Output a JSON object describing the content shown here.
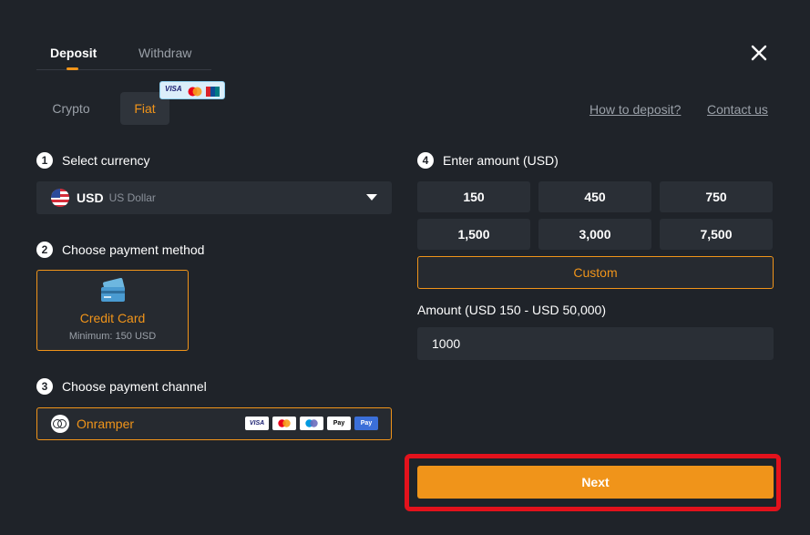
{
  "tabs": {
    "deposit": "Deposit",
    "withdraw": "Withdraw"
  },
  "subtabs": {
    "crypto": "Crypto",
    "fiat": "Fiat"
  },
  "card_badge": {
    "icons": [
      "VISA",
      "mastercard",
      "unionpay"
    ],
    "visa": "VISA"
  },
  "links": {
    "how_to": "How to deposit?",
    "contact": "Contact us"
  },
  "steps": {
    "s1": {
      "num": "1",
      "label": "Select currency"
    },
    "s2": {
      "num": "2",
      "label": "Choose payment method"
    },
    "s3": {
      "num": "3",
      "label": "Choose payment channel"
    },
    "s4": {
      "num": "4",
      "label": "Enter amount (USD)"
    }
  },
  "currency": {
    "code": "USD",
    "name": "US Dollar",
    "icon": "us-flag-icon"
  },
  "payment_method": {
    "name": "Credit Card",
    "min": "Minimum: 150 USD",
    "icon": "credit-card-icon"
  },
  "channel": {
    "name": "Onramper",
    "icons": [
      "VISA",
      "mastercard",
      "maestro",
      "apple-pay",
      "google-pay"
    ],
    "visa": "VISA",
    "apay": "Pay",
    "gpay": "Pay"
  },
  "amounts": [
    "150",
    "450",
    "750",
    "1,500",
    "3,000",
    "7,500"
  ],
  "custom_label": "Custom",
  "amount_label": "Amount (USD 150 - USD 50,000)",
  "amount_value": "1000",
  "next_label": "Next",
  "colors": {
    "accent": "#f0941a",
    "background": "#1f2329",
    "highlight": "#e3121c"
  }
}
